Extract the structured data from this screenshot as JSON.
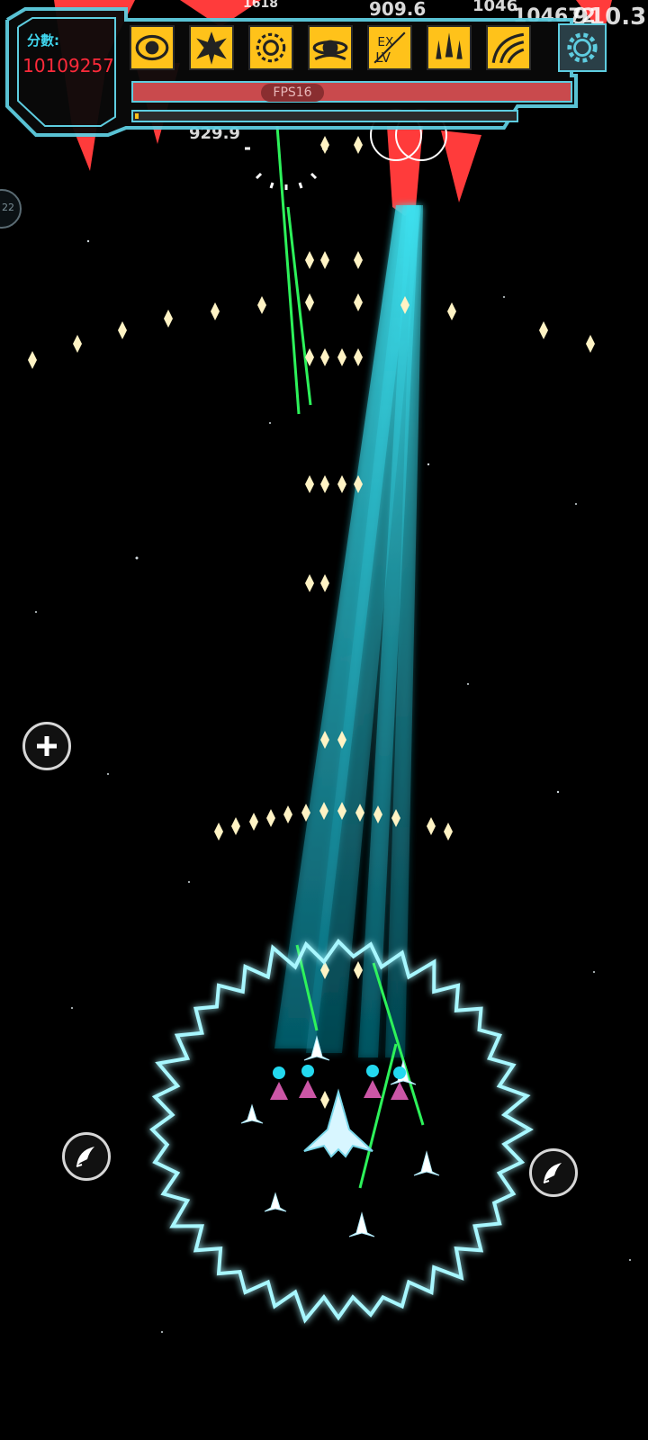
{
  "hud": {
    "score_label": "分數:",
    "score_value": "10109257",
    "fps_label": "FPS16",
    "hp_fraction": 1.0,
    "exp_fraction": 0.01,
    "skills": [
      {
        "name": "eye-skill-icon"
      },
      {
        "name": "burst-skill-icon"
      },
      {
        "name": "gear-burst-skill-icon"
      },
      {
        "name": "planet-skill-icon"
      },
      {
        "name": "ex-level-skill-icon"
      },
      {
        "name": "triple-missile-skill-icon"
      },
      {
        "name": "wave-skill-icon"
      }
    ],
    "settings_icon": "gear-icon"
  },
  "damage_numbers": [
    "1618",
    "909.6",
    "1046",
    "104672",
    "910.3",
    "929.9"
  ],
  "side_badge": "22",
  "controls": {
    "add_button": "plus-icon",
    "left_skill_button": "missile-icon",
    "right_skill_button": "missile-icon"
  },
  "colors": {
    "accent": "#5ecde0",
    "score_text": "#ff2a3a",
    "skill_bg": "#ffc21a",
    "hp_bar": "#c94a4d",
    "laser": "#1ec8d8",
    "enemy": "#ff3b3b",
    "bullet": "#fff3c4",
    "shield": "#a8f7ff"
  }
}
